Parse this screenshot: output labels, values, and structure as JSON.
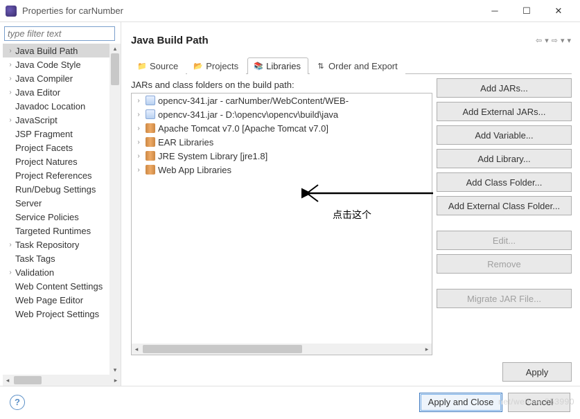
{
  "window": {
    "title": "Properties for carNumber"
  },
  "filter": {
    "placeholder": "type filter text"
  },
  "sidebar": {
    "items": [
      {
        "label": "Java Build Path",
        "expandable": true,
        "selected": true
      },
      {
        "label": "Java Code Style",
        "expandable": true
      },
      {
        "label": "Java Compiler",
        "expandable": true
      },
      {
        "label": "Java Editor",
        "expandable": true
      },
      {
        "label": "Javadoc Location",
        "expandable": false
      },
      {
        "label": "JavaScript",
        "expandable": true
      },
      {
        "label": "JSP Fragment",
        "expandable": false
      },
      {
        "label": "Project Facets",
        "expandable": false
      },
      {
        "label": "Project Natures",
        "expandable": false
      },
      {
        "label": "Project References",
        "expandable": false
      },
      {
        "label": "Run/Debug Settings",
        "expandable": false
      },
      {
        "label": "Server",
        "expandable": false
      },
      {
        "label": "Service Policies",
        "expandable": false
      },
      {
        "label": "Targeted Runtimes",
        "expandable": false
      },
      {
        "label": "Task Repository",
        "expandable": true
      },
      {
        "label": "Task Tags",
        "expandable": false
      },
      {
        "label": "Validation",
        "expandable": true
      },
      {
        "label": "Web Content Settings",
        "expandable": false
      },
      {
        "label": "Web Page Editor",
        "expandable": false
      },
      {
        "label": "Web Project Settings",
        "expandable": false
      }
    ]
  },
  "page": {
    "title": "Java Build Path"
  },
  "tabs": {
    "list": [
      {
        "label": "Source",
        "icon": "source-icon"
      },
      {
        "label": "Projects",
        "icon": "projects-icon"
      },
      {
        "label": "Libraries",
        "icon": "libraries-icon",
        "active": true
      },
      {
        "label": "Order and Export",
        "icon": "order-icon"
      }
    ]
  },
  "libraries": {
    "heading": "JARs and class folders on the build path:",
    "items": [
      {
        "label": "opencv-341.jar - carNumber/WebContent/WEB-",
        "icon": "jar"
      },
      {
        "label": "opencv-341.jar - D:\\opencv\\opencv\\build\\java",
        "icon": "jar"
      },
      {
        "label": "Apache Tomcat v7.0 [Apache Tomcat v7.0]",
        "icon": "lib"
      },
      {
        "label": "EAR Libraries",
        "icon": "lib"
      },
      {
        "label": "JRE System Library [jre1.8]",
        "icon": "lib"
      },
      {
        "label": "Web App Libraries",
        "icon": "lib"
      }
    ]
  },
  "buttons": {
    "addJars": "Add JARs...",
    "addExtJars": "Add External JARs...",
    "addVar": "Add Variable...",
    "addLib": "Add Library...",
    "addClassFolder": "Add Class Folder...",
    "addExtClassFolder": "Add External Class Folder...",
    "edit": "Edit...",
    "remove": "Remove",
    "migrate": "Migrate JAR File...",
    "apply": "Apply",
    "applyClose": "Apply and Close",
    "cancel": "Cancel"
  },
  "annotation": {
    "text": "点击这个"
  },
  "watermark": "net/weihao 853990"
}
